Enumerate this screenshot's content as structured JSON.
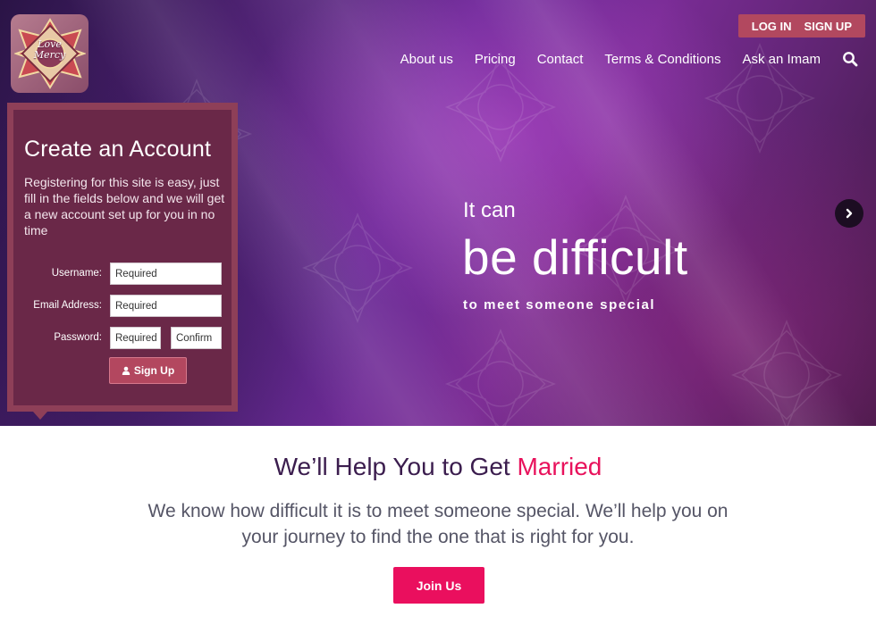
{
  "logo": {
    "line1": "Love",
    "line2": "Mercy"
  },
  "auth": {
    "login": "LOG IN",
    "signup": "SIGN UP"
  },
  "nav": {
    "items": [
      "About us",
      "Pricing",
      "Contact",
      "Terms & Conditions",
      "Ask an Imam"
    ],
    "search_icon": "search-icon"
  },
  "signup_form": {
    "title": "Create an Account",
    "description": "Registering for this site is easy, just fill in the fields below and we will get a new account set up for you in no time",
    "username_label": "Username:",
    "username_value": "Required",
    "email_label": "Email Address:",
    "email_value": "Required",
    "password_label": "Password:",
    "password_value": "Required",
    "confirm_value": "Confirm",
    "submit_label": "Sign Up",
    "submit_icon": "user-icon"
  },
  "hero": {
    "line1": "It can",
    "line2": "be difficult",
    "line3": "to meet someone special",
    "next_icon": "chevron-right-icon"
  },
  "section": {
    "title_main": "We’ll Help You to Get",
    "title_accent": "Married",
    "text": "We know how difficult it is to meet someone special. We’ll help you on your journey to find the one that is right for you.",
    "cta": "Join Us"
  },
  "colors": {
    "accent": "#e8125c",
    "panel": "#6a2848",
    "panel_border": "#8e3f58",
    "auth_bar": "#b2485f",
    "heading": "#3b1d4e"
  }
}
